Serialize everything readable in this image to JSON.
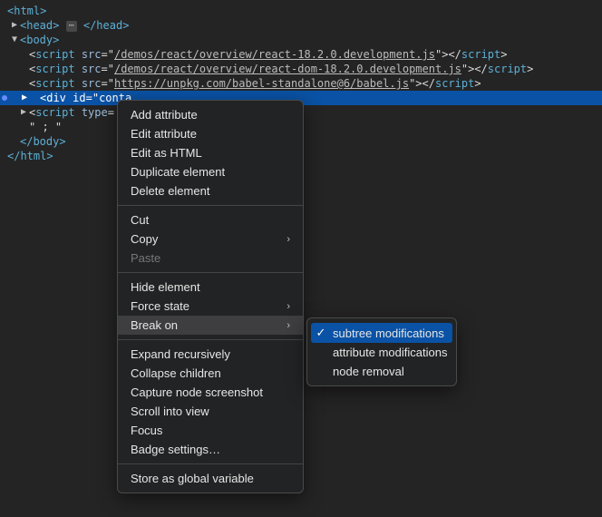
{
  "dom": {
    "html_open": "<html>",
    "head_open": "<head>",
    "head_close": "</head>",
    "body_open": "<body>",
    "body_close": "</body>",
    "html_close": "</html>",
    "script_tag": "script",
    "div_tag": "div",
    "src_attr": "src",
    "id_attr": "id",
    "type_attr": "type",
    "eq_q": "=\"",
    "q_close": "\">",
    "script_close": "</",
    "close_gt": ">",
    "src1": "/demos/react/overview/react-18.2.0.development.js",
    "src2": "/demos/react/overview/react-dom-18.2.0.development.js",
    "src3": "https://unpkg.com/babel-standalone@6/babel.js",
    "div_id_prefix": "conta",
    "text_node": "\" ; \""
  },
  "menu1": {
    "add_attr": "Add attribute",
    "edit_attr": "Edit attribute",
    "edit_html": "Edit as HTML",
    "dup": "Duplicate element",
    "del": "Delete element",
    "cut": "Cut",
    "copy": "Copy",
    "paste": "Paste",
    "hide": "Hide element",
    "force": "Force state",
    "break": "Break on",
    "expand": "Expand recursively",
    "collapse": "Collapse children",
    "capture": "Capture node screenshot",
    "scroll": "Scroll into view",
    "focus": "Focus",
    "badge": "Badge settings…",
    "store": "Store as global variable"
  },
  "menu2": {
    "subtree": "subtree modifications",
    "attr": "attribute modifications",
    "node": "node removal"
  }
}
